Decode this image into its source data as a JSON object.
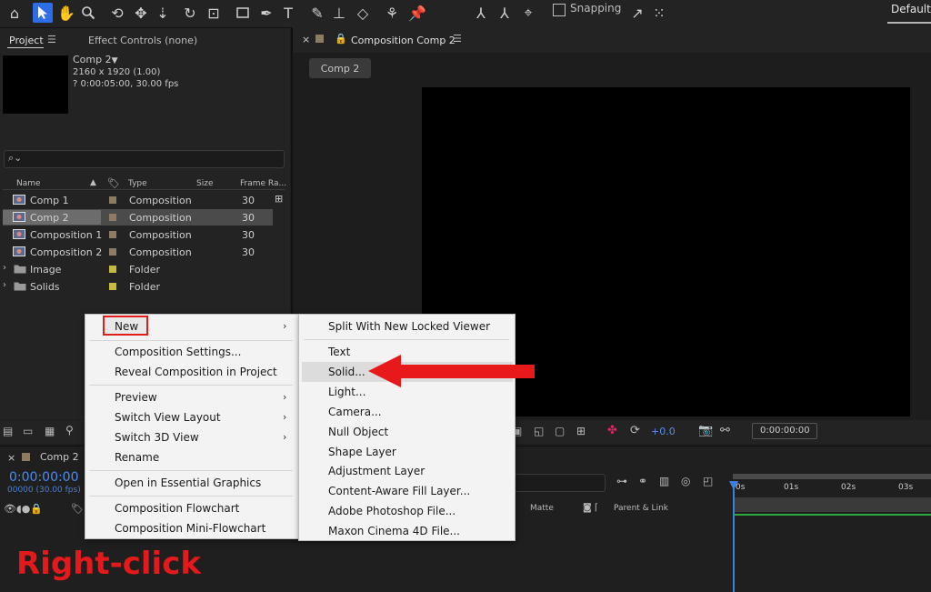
{
  "toolbar": {
    "snapping_label": "Snapping",
    "workspace_label": "Default"
  },
  "project_panel": {
    "tab_project": "Project",
    "tab_effect_controls": "Effect Controls (none)",
    "selected_name": "Comp 2",
    "selected_dims": "2160 x 1920 (1.00)",
    "selected_duration": "? 0:00:05:00, 30.00 fps",
    "columns": {
      "name": "Name",
      "type": "Type",
      "size": "Size",
      "frame_rate": "Frame Ra..."
    },
    "items": [
      {
        "name": "Comp 1",
        "type": "Composition",
        "fps": "30",
        "kind": "comp",
        "selected": false,
        "color": "#8d7b63"
      },
      {
        "name": "Comp 2",
        "type": "Composition",
        "fps": "30",
        "kind": "comp",
        "selected": true,
        "color": "#8d7b63"
      },
      {
        "name": "Composition 1",
        "type": "Composition",
        "fps": "30",
        "kind": "comp",
        "selected": false,
        "color": "#8d7b63"
      },
      {
        "name": "Composition 2",
        "type": "Composition",
        "fps": "30",
        "kind": "comp",
        "selected": false,
        "color": "#8d7b63"
      },
      {
        "name": "Image",
        "type": "Folder",
        "fps": "",
        "kind": "folder",
        "selected": false,
        "color": "#c7b93b"
      },
      {
        "name": "Solids",
        "type": "Folder",
        "fps": "",
        "kind": "folder",
        "selected": false,
        "color": "#c7b93b"
      }
    ]
  },
  "viewer": {
    "tab_label": "Composition Comp 2",
    "comp_button": "Comp 2",
    "exposure": "+0.0",
    "timecode": "0:00:00:00"
  },
  "timeline": {
    "tab_label": "Comp 2",
    "timecode": "0:00:00:00",
    "frames": "00000 (30.00 fps)",
    "track_matte": "Matte",
    "parent_link": "Parent & Link",
    "ruler": [
      "0s",
      "01s",
      "02s",
      "03s"
    ]
  },
  "context_menu": {
    "items": [
      {
        "label": "New",
        "submenu": true
      },
      {
        "label": "Composition Settings...",
        "submenu": false
      },
      {
        "label": "Reveal Composition in Project",
        "submenu": false
      },
      {
        "label": "Preview",
        "submenu": true
      },
      {
        "label": "Switch View Layout",
        "submenu": true
      },
      {
        "label": "Switch 3D View",
        "submenu": true
      },
      {
        "label": "Rename",
        "submenu": false
      },
      {
        "label": "Open in Essential Graphics",
        "submenu": false
      },
      {
        "label": "Composition Flowchart",
        "submenu": false
      },
      {
        "label": "Composition Mini-Flowchart",
        "submenu": false
      }
    ]
  },
  "submenu": {
    "items": [
      {
        "label": "Split With New Locked Viewer"
      },
      {
        "label": "Text"
      },
      {
        "label": "Solid..."
      },
      {
        "label": "Light..."
      },
      {
        "label": "Camera..."
      },
      {
        "label": "Null Object"
      },
      {
        "label": "Shape Layer"
      },
      {
        "label": "Adjustment Layer"
      },
      {
        "label": "Content-Aware Fill Layer..."
      },
      {
        "label": "Adobe Photoshop File..."
      },
      {
        "label": "Maxon Cinema 4D File..."
      }
    ]
  },
  "annotation": {
    "text": "Right-click",
    "color": "#e4191b"
  }
}
